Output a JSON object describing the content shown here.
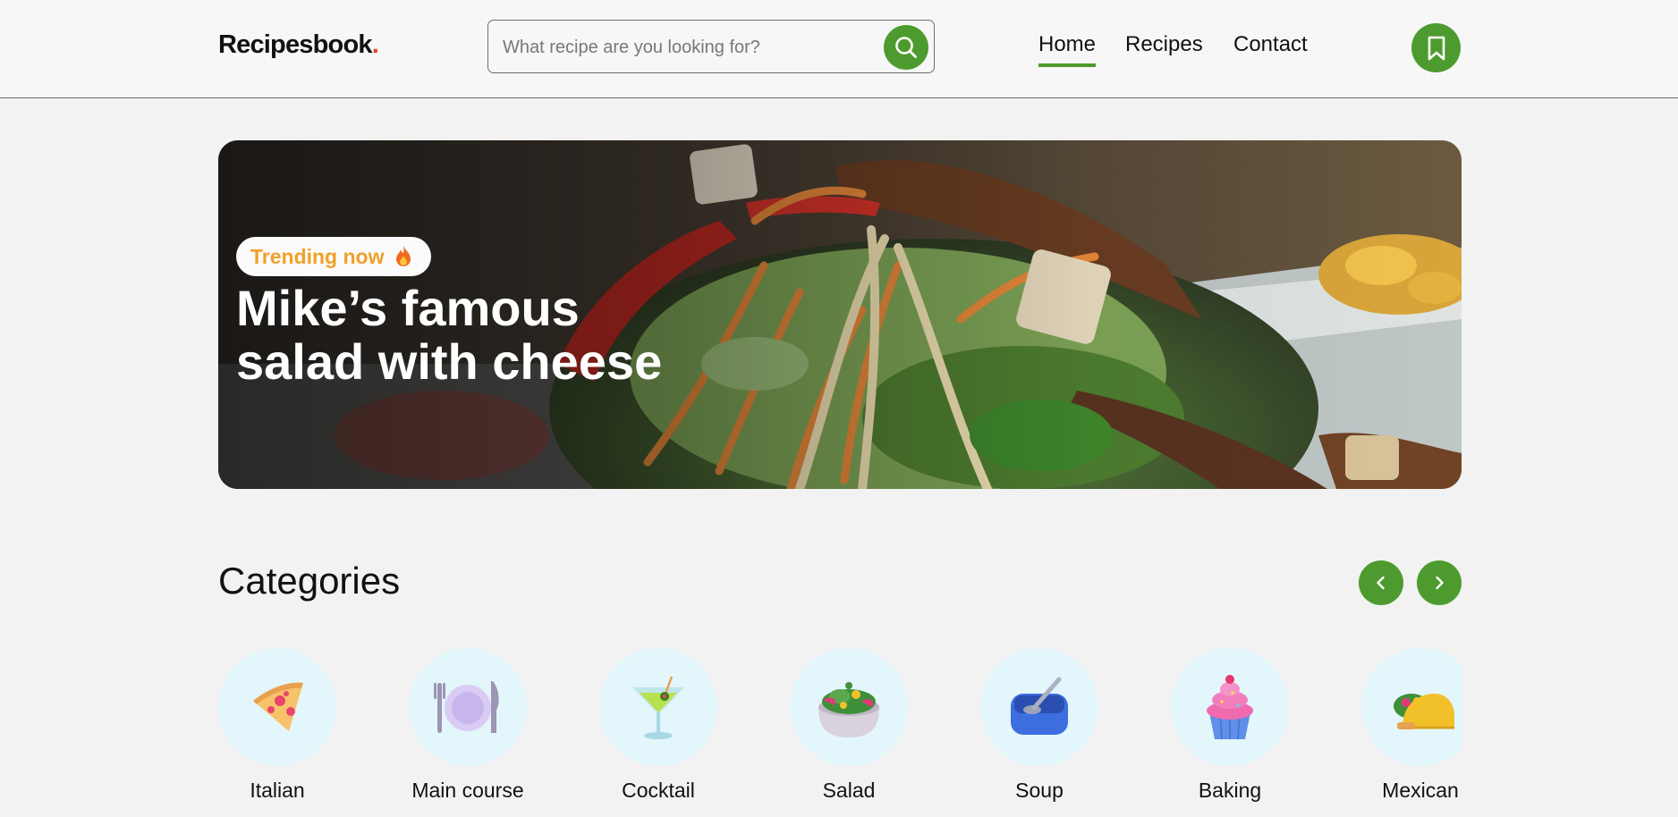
{
  "header": {
    "logo_text": "Recipesbook",
    "logo_dot": ".",
    "search_placeholder": "What recipe are you looking for?",
    "nav": [
      {
        "label": "Home",
        "active": true
      },
      {
        "label": "Recipes",
        "active": false
      },
      {
        "label": "Contact",
        "active": false
      }
    ],
    "icons": {
      "search": "search-icon",
      "bookmark": "bookmark-icon"
    }
  },
  "hero": {
    "badge_label": "Trending now",
    "badge_icon": "fire-icon",
    "title": "Mike’s famous\nsalad with cheese"
  },
  "categories": {
    "title": "Categories",
    "items": [
      {
        "label": "Italian",
        "icon": "pizza-icon"
      },
      {
        "label": "Main course",
        "icon": "plate-cutlery-icon"
      },
      {
        "label": "Cocktail",
        "icon": "cocktail-icon"
      },
      {
        "label": "Salad",
        "icon": "salad-bowl-icon"
      },
      {
        "label": "Soup",
        "icon": "soup-bowl-icon"
      },
      {
        "label": "Baking",
        "icon": "cupcake-icon"
      },
      {
        "label": "Mexican",
        "icon": "taco-icon"
      }
    ]
  },
  "colors": {
    "accent": "#4d9b2e",
    "badge_text": "#f0a12a",
    "logo_dot": "#e0442c",
    "category_circle": "#e3f6fb",
    "background": "#f2f2f2"
  }
}
